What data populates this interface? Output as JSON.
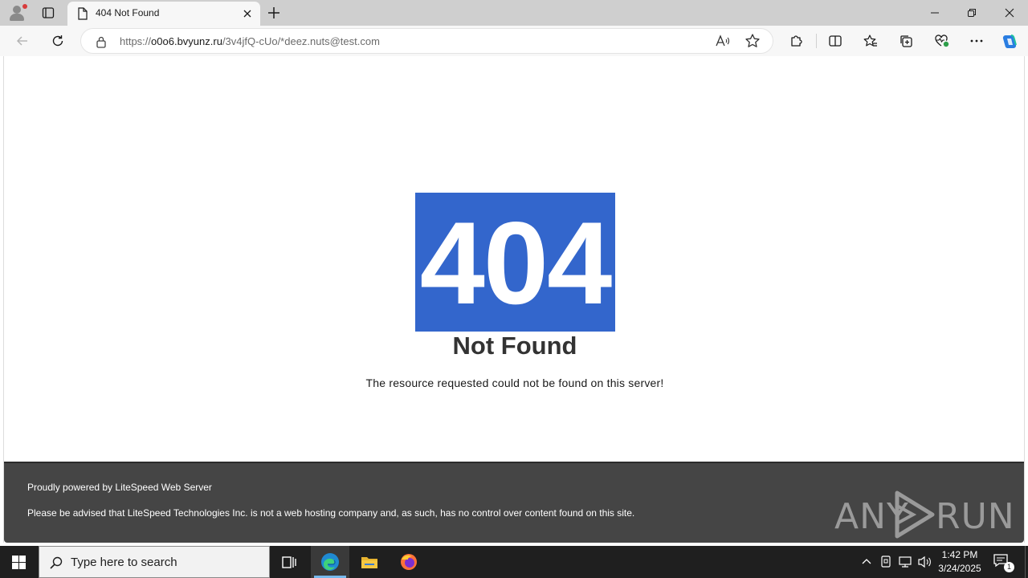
{
  "tab": {
    "title": "404 Not Found"
  },
  "address": {
    "scheme": "https://",
    "host": "o0o6.bvyunz.ru",
    "path": "/3v4jfQ-cUo/*deez.nuts@test.com"
  },
  "page": {
    "error_code": "404",
    "error_title": "Not Found",
    "error_message": "The resource requested could not be found on this server!",
    "footer_line1": "Proudly powered by LiteSpeed Web Server",
    "footer_line2": "Please be advised that LiteSpeed Technologies Inc. is not a web hosting company and, as such, has no control over content found on this site.",
    "error_box_color": "#3366cc",
    "footer_color": "#454545"
  },
  "watermark": {
    "left": "ANY",
    "right": "RUN"
  },
  "taskbar": {
    "search_placeholder": "Type here to search",
    "time": "1:42 PM",
    "date": "3/24/2025",
    "notification_count": "1"
  }
}
